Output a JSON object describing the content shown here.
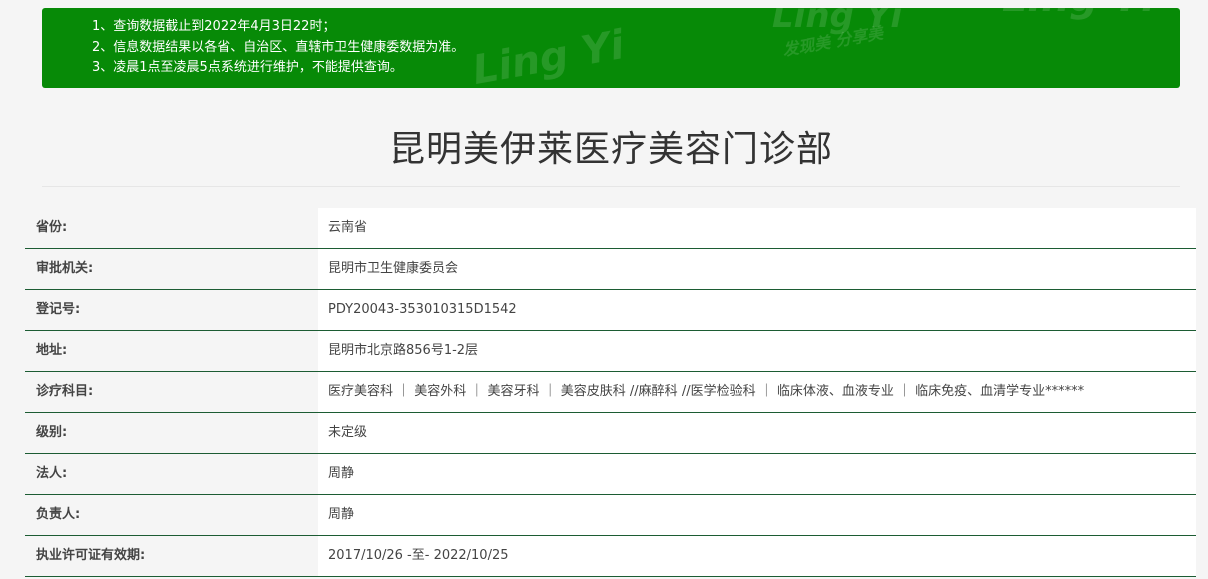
{
  "notice": {
    "lines": [
      "1、查询数据截止到2022年4月3日22时；",
      "2、信息数据结果以各省、自治区、直辖市卫生健康委数据为准。",
      "3、凌晨1点至凌晨5点系统进行维护，不能提供查询。"
    ],
    "watermark": [
      "Ling Yi",
      "发现美 分享美"
    ],
    "background": "#078a07"
  },
  "page_title": "昆明美伊莱医疗美容门诊部",
  "details": [
    {
      "label": "省份:",
      "value": "云南省"
    },
    {
      "label": "审批机关:",
      "value": "昆明市卫生健康委员会"
    },
    {
      "label": "登记号:",
      "value": "PDY20043-353010315D1542"
    },
    {
      "label": "地址:",
      "value": "昆明市北京路856号1-2层"
    },
    {
      "label": "诊疗科目:",
      "value": "医疗美容科 ｜ 美容外科 ｜ 美容牙科 ｜ 美容皮肤科 //麻醉科 //医学检验科 ｜ 临床体液、血液专业 ｜ 临床免疫、血清学专业******"
    },
    {
      "label": "级别:",
      "value": "未定级"
    },
    {
      "label": "法人:",
      "value": "周静"
    },
    {
      "label": "负责人:",
      "value": "周静"
    },
    {
      "label": "执业许可证有效期:",
      "value": "2017/10/26 -至- 2022/10/25"
    }
  ],
  "colors": {
    "row_divider": "#1c5c33",
    "page_background": "#f5f5f5"
  }
}
